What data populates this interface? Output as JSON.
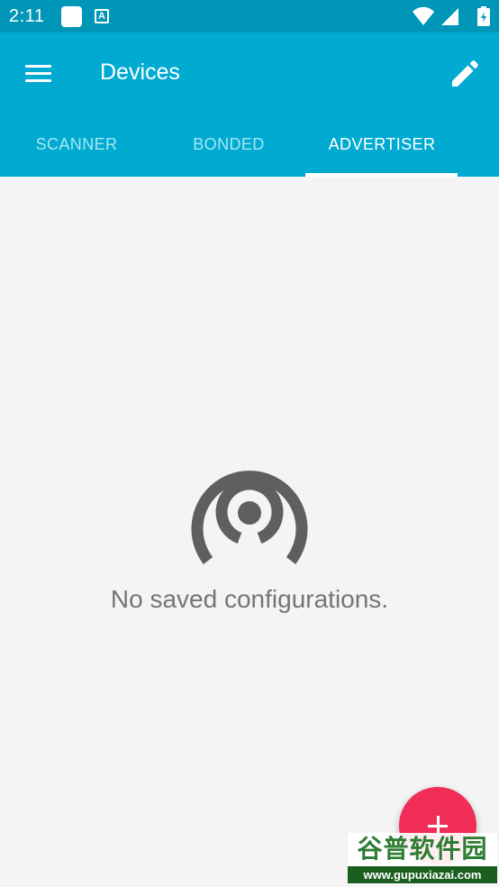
{
  "status_bar": {
    "time": "2:11",
    "notification_letter": "A",
    "icons": [
      "wifi-icon",
      "signal-icon",
      "battery-icon"
    ]
  },
  "app_bar": {
    "title": "Devices",
    "menu_icon": "hamburger-menu-icon",
    "action_icon": "edit-pencil-icon"
  },
  "tabs": [
    {
      "label": "SCANNER",
      "active": false
    },
    {
      "label": "BONDED",
      "active": false
    },
    {
      "label": "ADVERTISER",
      "active": true
    }
  ],
  "empty_state": {
    "icon": "advertising-broadcast-icon",
    "message": "No saved configurations."
  },
  "fab": {
    "icon": "plus-icon"
  },
  "watermark": {
    "title": "谷普软件园",
    "url": "www.gupuxiazai.com"
  },
  "colors": {
    "status_bar": "#0096b8",
    "app_bar": "#00aad1",
    "fab": "#ef2d56",
    "background": "#f4f4f4",
    "empty_icon": "#5f5f5f",
    "empty_text": "#757575"
  }
}
